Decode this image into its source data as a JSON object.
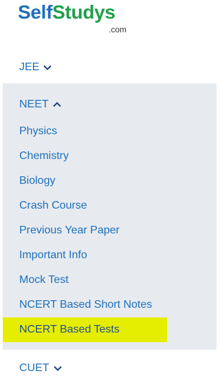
{
  "brand": {
    "name_part1": "Self",
    "name_part2": "Studys",
    "domain_suffix": ".com",
    "color_primary": "#1f6fb8",
    "color_accent": "#1f9f4a"
  },
  "menu": {
    "jee": {
      "label": "JEE",
      "icon": "chevron-down-icon"
    },
    "neet": {
      "label": "NEET",
      "icon": "chevron-up-icon",
      "expanded": true,
      "items": [
        {
          "label": "Physics"
        },
        {
          "label": "Chemistry"
        },
        {
          "label": "Biology"
        },
        {
          "label": "Crash Course"
        },
        {
          "label": "Previous Year Paper"
        },
        {
          "label": "Important Info"
        },
        {
          "label": "Mock Test"
        },
        {
          "label": "NCERT Based Short Notes"
        },
        {
          "label": "NCERT Based Tests",
          "highlighted": true
        }
      ]
    },
    "cuet": {
      "label": "CUET",
      "icon": "chevron-down-icon"
    }
  },
  "colors": {
    "link": "#1f6fb8",
    "panel_bg": "#e7ebf0",
    "highlight": "#e6ee00"
  }
}
